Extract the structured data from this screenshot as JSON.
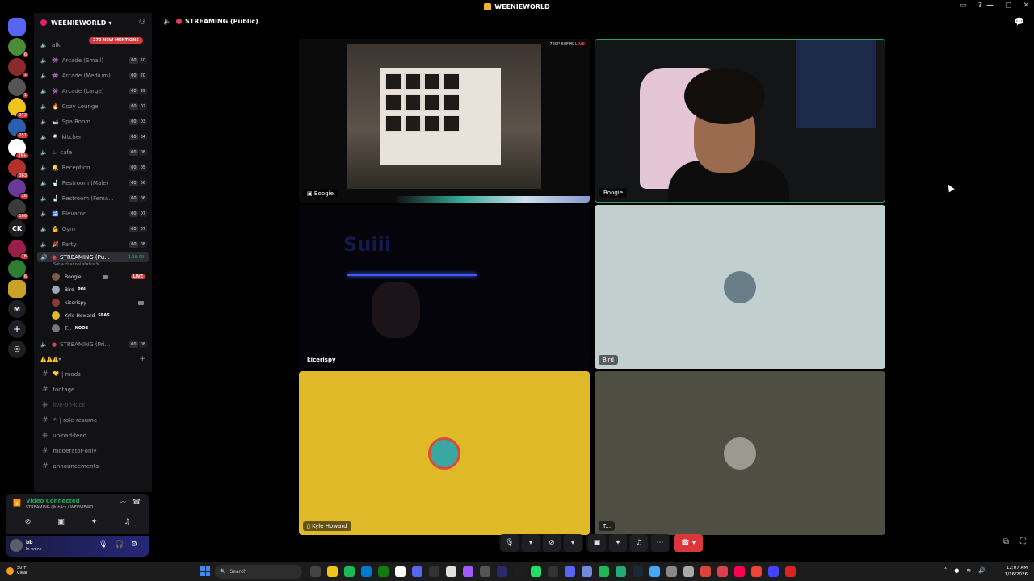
{
  "window": {
    "title": "WEENIEWORLD"
  },
  "servers": [
    {
      "badge": "6"
    },
    {
      "badge": "1"
    },
    {
      "badge": "1"
    },
    {
      "badge": "272"
    },
    {
      "badge": "251"
    },
    {
      "badge": "2K+"
    },
    {
      "badge": "363"
    },
    {
      "badge": "26"
    },
    {
      "badge": "186"
    },
    {
      "label": "CK"
    },
    {
      "badge": "16"
    },
    {
      "badge": "6"
    },
    {
      "badge": ""
    },
    {
      "label": "M"
    }
  ],
  "guild": {
    "name": "WEENIEWORLD",
    "mentions": "272 NEW MENTIONS"
  },
  "channels": [
    {
      "name": "afk",
      "emoji": ""
    },
    {
      "name": "Arcade (Small)",
      "emoji": "👾",
      "c1": "00",
      "c2": "10"
    },
    {
      "name": "Arcade (Medium)",
      "emoji": "👾",
      "c1": "00",
      "c2": "20"
    },
    {
      "name": "Arcade (Large)",
      "emoji": "👾",
      "c1": "00",
      "c2": "99"
    },
    {
      "name": "Cozy Lounge",
      "emoji": "🔥",
      "c1": "00",
      "c2": "02"
    },
    {
      "name": "Spa Room",
      "emoji": "🛁",
      "c1": "00",
      "c2": "03"
    },
    {
      "name": "kitchen",
      "emoji": "🍳",
      "c1": "00",
      "c2": "04"
    },
    {
      "name": "cafe",
      "emoji": "☕",
      "c1": "00",
      "c2": "08"
    },
    {
      "name": "Reception",
      "emoji": "🔔",
      "c1": "00",
      "c2": "05"
    },
    {
      "name": "Restroom (Male)",
      "emoji": "🚽",
      "c1": "00",
      "c2": "06"
    },
    {
      "name": "Restroom (Fema...",
      "emoji": "🚽",
      "c1": "00",
      "c2": "06"
    },
    {
      "name": "Elevator",
      "emoji": "🛗",
      "c1": "00",
      "c2": "07"
    },
    {
      "name": "Gym",
      "emoji": "💪",
      "c1": "00",
      "c2": "07"
    },
    {
      "name": "Party",
      "emoji": "🎉",
      "c1": "00",
      "c2": "08"
    }
  ],
  "active_channel": {
    "name": "STREAMING (Pu...",
    "timer": "1:15:09",
    "status": "Set a channel status"
  },
  "members": [
    {
      "name": "Boogie",
      "tag": "",
      "live": "LIVE"
    },
    {
      "name": "Bird",
      "tag": "POI"
    },
    {
      "name": "kicerispy",
      "tag": ""
    },
    {
      "name": "Kyle Howard",
      "tag": "SEAS"
    },
    {
      "name": "T...",
      "tag": "NOOB"
    }
  ],
  "private_channel": {
    "name": "STREAMING (Pri...",
    "c1": "00",
    "c2": "08"
  },
  "category": {
    "name": "⚠️⚠️⚠️"
  },
  "text_channels": [
    "| mods",
    "footage",
    "live-on-kick",
    "| role-resume",
    "upload-feed",
    "moderator-only",
    "announcements"
  ],
  "voice": {
    "title": "Video Connected",
    "sub": "STREAMING (Public) / WEENIEWO..."
  },
  "user": {
    "name": "bb",
    "status": "In voice"
  },
  "stream": {
    "title": "STREAMING (Public)",
    "quality": "720P 60FPS",
    "live": "LIVE"
  },
  "tiles": [
    {
      "name": "Boogie"
    },
    {
      "name": "Boogie"
    },
    {
      "name": "kicerispy"
    },
    {
      "name": "Bird"
    },
    {
      "name": "Kyle Howard"
    },
    {
      "name": "T..."
    }
  ],
  "taskbar": {
    "temp": "50°F",
    "cond": "Clear",
    "search": "Search",
    "time": "12:07 AM",
    "date": "1/16/2026"
  },
  "colors": {
    "accent": "#23a55a",
    "danger": "#da373c",
    "brand": "#5865f2"
  }
}
